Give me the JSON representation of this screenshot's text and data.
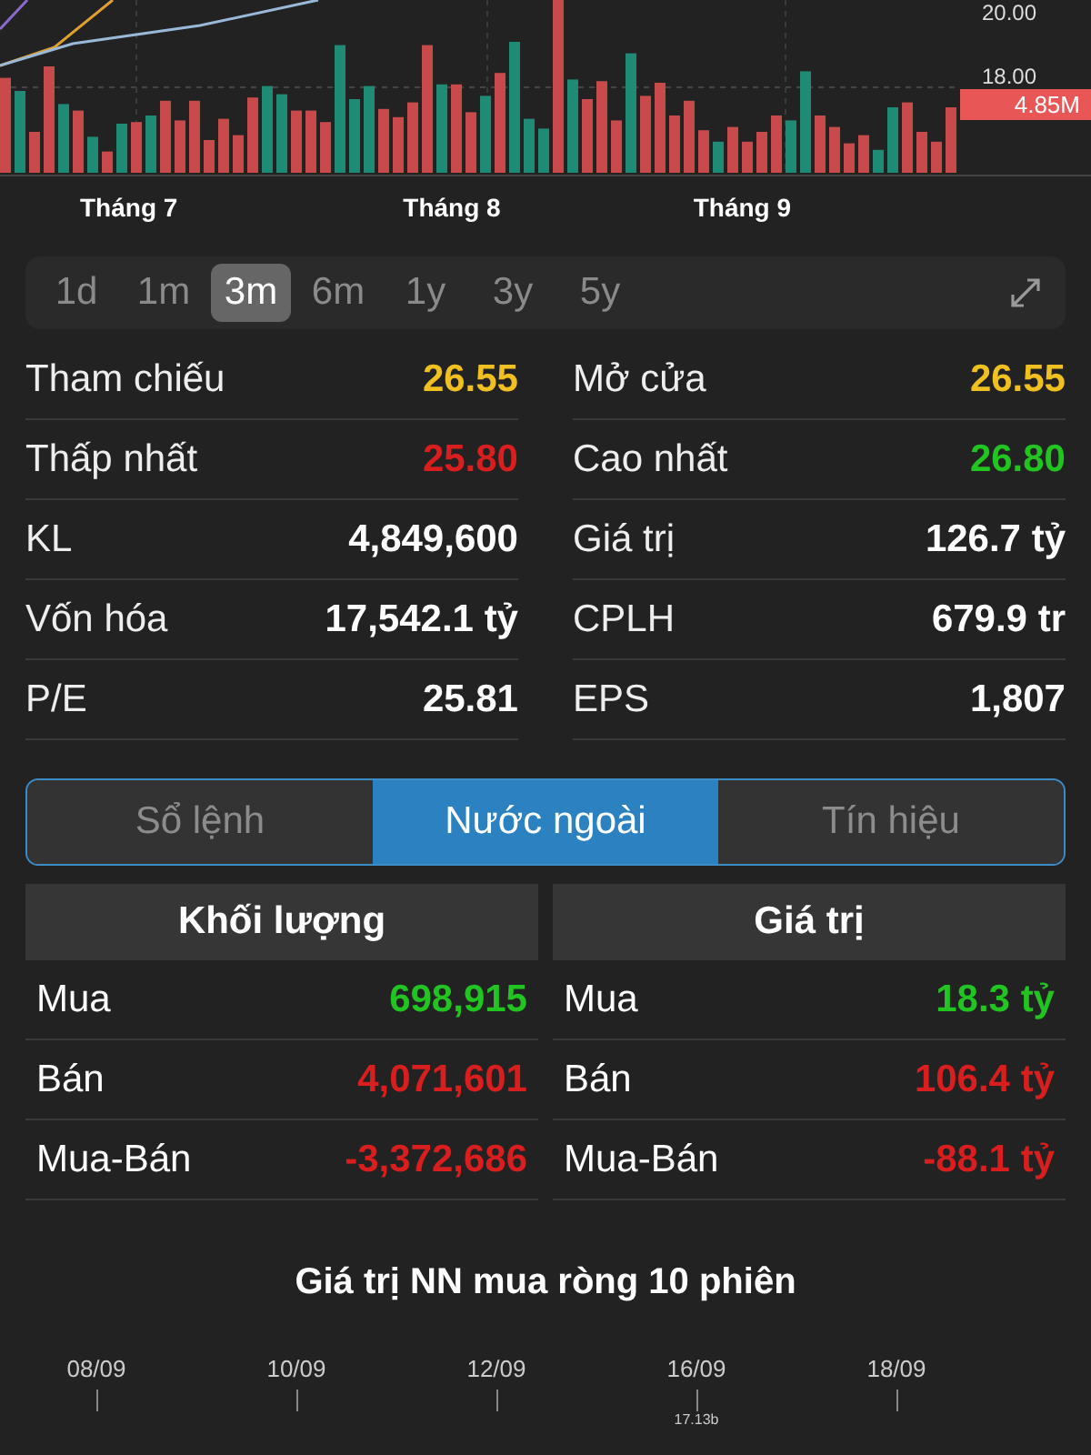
{
  "chart": {
    "price_labels": [
      "20.00",
      "18.00"
    ],
    "volume_badge": "4.85M",
    "months": [
      "Tháng 7",
      "Tháng 8",
      "Tháng 9"
    ]
  },
  "periods": [
    {
      "label": "1d",
      "selected": false
    },
    {
      "label": "1m",
      "selected": false
    },
    {
      "label": "3m",
      "selected": true
    },
    {
      "label": "6m",
      "selected": false
    },
    {
      "label": "1y",
      "selected": false
    },
    {
      "label": "3y",
      "selected": false
    },
    {
      "label": "5y",
      "selected": false
    }
  ],
  "stats": [
    {
      "label": "Tham chiếu",
      "value": "26.55",
      "color": "#f0c020"
    },
    {
      "label": "Mở cửa",
      "value": "26.55",
      "color": "#f0c020"
    },
    {
      "label": "Thấp nhất",
      "value": "25.80",
      "color": "#d81e1e"
    },
    {
      "label": "Cao nhất",
      "value": "26.80",
      "color": "#22c422"
    },
    {
      "label": "KL",
      "value": "4,849,600",
      "color": "#ffffff"
    },
    {
      "label": "Giá trị",
      "value": "126.7 tỷ",
      "color": "#ffffff"
    },
    {
      "label": "Vốn hóa",
      "value": "17,542.1 tỷ",
      "color": "#ffffff"
    },
    {
      "label": "CPLH",
      "value": "679.9 tr",
      "color": "#ffffff"
    },
    {
      "label": "P/E",
      "value": "25.81",
      "color": "#ffffff"
    },
    {
      "label": "EPS",
      "value": "1,807",
      "color": "#ffffff"
    }
  ],
  "tabs": [
    {
      "label": "Sổ lệnh",
      "selected": false
    },
    {
      "label": "Nước ngoài",
      "selected": true
    },
    {
      "label": "Tín hiệu",
      "selected": false
    }
  ],
  "foreign": [
    {
      "title": "Khối lượng",
      "rows": [
        {
          "label": "Mua",
          "value": "698,915",
          "color": "#22c422"
        },
        {
          "label": "Bán",
          "value": "4,071,601",
          "color": "#d81e1e"
        },
        {
          "label": "Mua-Bán",
          "value": "-3,372,686",
          "color": "#d81e1e"
        }
      ]
    },
    {
      "title": "Giá trị",
      "rows": [
        {
          "label": "Mua",
          "value": "18.3 tỷ",
          "color": "#22c422"
        },
        {
          "label": "Bán",
          "value": "106.4 tỷ",
          "color": "#d81e1e"
        },
        {
          "label": "Mua-Bán",
          "value": "-88.1 tỷ",
          "color": "#d81e1e"
        }
      ]
    }
  ],
  "net_chart": {
    "title": "Giá trị NN mua ròng 10 phiên",
    "dates": [
      "08/09",
      "10/09",
      "12/09",
      "16/09",
      "18/09"
    ],
    "callout": "17.13b"
  }
}
